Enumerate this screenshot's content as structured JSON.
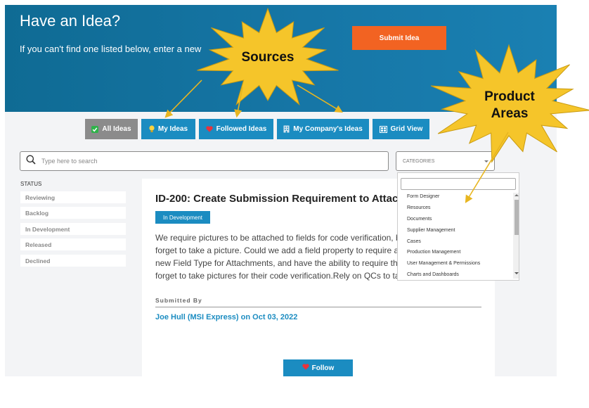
{
  "hero": {
    "title": "Have an Idea?",
    "subtitle": "If you can't find one listed below, enter a new",
    "submit_label": "Submit Idea"
  },
  "tabs": [
    {
      "label": "All Ideas",
      "icon": "check-icon",
      "selected": true
    },
    {
      "label": "My Ideas",
      "icon": "lightbulb-icon",
      "selected": false
    },
    {
      "label": "Followed Ideas",
      "icon": "heart-icon",
      "selected": false
    },
    {
      "label": "My Company's Ideas",
      "icon": "building-icon",
      "selected": false
    },
    {
      "label": "Grid View",
      "icon": "grid-icon",
      "selected": false
    }
  ],
  "search": {
    "placeholder": "Type here to search"
  },
  "categories": {
    "label": "CATEGORIES",
    "options": [
      "Form Designer",
      "Resources",
      "Documents",
      "Supplier Management",
      "Cases",
      "Production Management",
      "User Management & Permissions",
      "Charts and Dashboards"
    ]
  },
  "status": {
    "label": "STATUS",
    "items": [
      "Reviewing",
      "Backlog",
      "In Development",
      "Released",
      "Declined"
    ]
  },
  "idea": {
    "title": "ID-200: Create Submission Requirement to Attach",
    "badge": "In Development",
    "lines": [
      "We require pictures to be attached to fields for code verification, b",
      "forget to take a picture. Could we add a field property to require at",
      "new Field Type for Attachments, and have the ability to require tha",
      "forget to take pictures for their code verification.Rely on QCs to tak"
    ],
    "submitted_label": "Submitted By",
    "author": "Joe Hull (MSI Express) on Oct 03, 2022",
    "follow_label": "Follow"
  },
  "annotations": {
    "sources": "Sources",
    "product_areas_line1": "Product",
    "product_areas_line2": "Areas"
  },
  "colors": {
    "hero": "#1676a6",
    "accent_orange": "#f26322",
    "tab_blue": "#1b8cc1",
    "tab_gray": "#8b8b8b",
    "burst_yellow": "#f5c52a"
  }
}
